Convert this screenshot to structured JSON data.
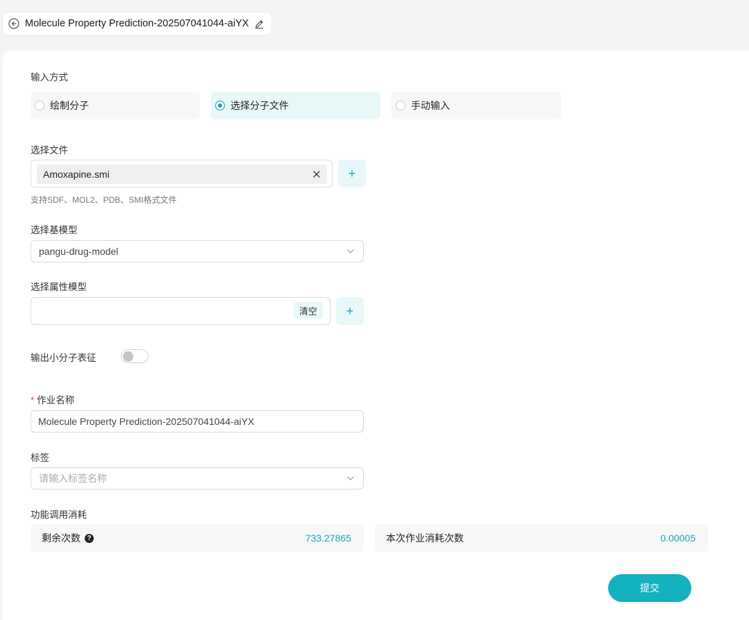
{
  "header": {
    "title": "Molecule Property Prediction-202507041044-aiYX",
    "back_icon": "back-circle-icon",
    "edit_icon": "pencil-icon"
  },
  "input_method": {
    "label": "输入方式",
    "options": [
      {
        "label": "绘制分子",
        "selected": false
      },
      {
        "label": "选择分子文件",
        "selected": true
      },
      {
        "label": "手动输入",
        "selected": false
      }
    ]
  },
  "file_select": {
    "label": "选择文件",
    "file_name": "Amoxapine.smi",
    "add_label": "+",
    "hint": "支持SDF、MOL2、PDB、SMI格式文件"
  },
  "base_model": {
    "label": "选择基模型",
    "value": "pangu-drug-model"
  },
  "attr_model": {
    "label": "选择属性模型",
    "clear_label": "清空",
    "add_label": "+"
  },
  "output_repr": {
    "label": "输出小分子表征",
    "enabled": false
  },
  "job_name": {
    "required_mark": "*",
    "label": "作业名称",
    "value": "Molecule Property Prediction-202507041044-aiYX"
  },
  "tags": {
    "label": "标签",
    "placeholder": "请输入标签名称"
  },
  "cost": {
    "label": "功能调用消耗",
    "remaining_label": "剩余次数",
    "remaining_value": "733.27865",
    "this_job_label": "本次作业消耗次数",
    "this_job_value": "0.00005"
  },
  "submit_label": "提交",
  "colors": {
    "accent": "#14a7b8",
    "accent_light": "#e8f7f8"
  }
}
